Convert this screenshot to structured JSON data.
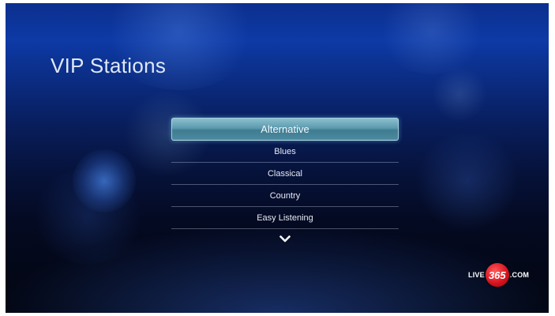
{
  "title": "VIP Stations",
  "stations": {
    "items": [
      {
        "label": "Alternative",
        "selected": true
      },
      {
        "label": "Blues",
        "selected": false
      },
      {
        "label": "Classical",
        "selected": false
      },
      {
        "label": "Country",
        "selected": false
      },
      {
        "label": "Easy Listening",
        "selected": false
      }
    ]
  },
  "more_icon": "chevron-down-icon",
  "logo": {
    "left": "LIVE",
    "number": "365",
    "right": ".COM"
  },
  "colors": {
    "accent": "#5c9aae",
    "background_top": "#0d3aa6",
    "background_bottom": "#02050f",
    "text": "#e6ebf4",
    "logo_red": "#d4101c"
  }
}
